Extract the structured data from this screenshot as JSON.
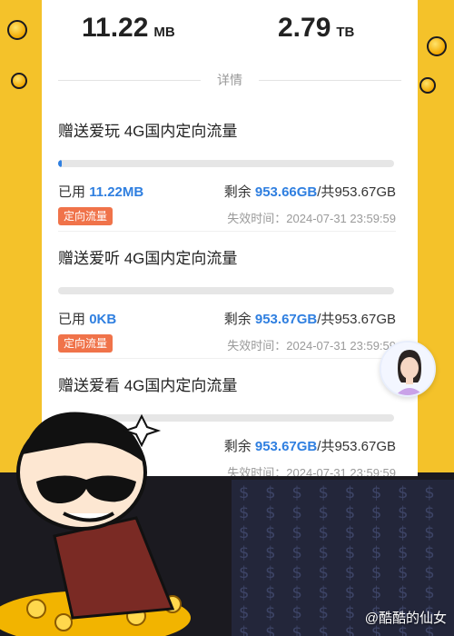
{
  "totals": [
    {
      "value": "11.22",
      "unit": "MB"
    },
    {
      "value": "2.79",
      "unit": "TB"
    }
  ],
  "section_label": "详情",
  "packages": [
    {
      "name": "赠送爱玩 4G国内定向流量",
      "used_label": "已用",
      "used_value": "11.22MB",
      "remain_label": "剩余",
      "remain_value": "953.66GB",
      "total_prefix": "/共",
      "total_value": "953.67GB",
      "usage_fraction": 0.012,
      "tag": "定向流量",
      "expire": "失效时间：2024-07-31 23:59:59"
    },
    {
      "name": "赠送爱听 4G国内定向流量",
      "used_label": "已用",
      "used_value": "0KB",
      "remain_label": "剩余",
      "remain_value": "953.67GB",
      "total_prefix": "/共",
      "total_value": "953.67GB",
      "usage_fraction": 0.0,
      "tag": "定向流量",
      "expire": "失效时间：2024-07-31 23:59:59"
    },
    {
      "name": "赠送爱看 4G国内定向流量",
      "remain_label": "剩余",
      "remain_value": "953.67GB",
      "total_prefix": "/共",
      "total_value": "953.67GB",
      "usage_fraction": 0.0,
      "expire": "失效时间：2024-07-31 23:59:59"
    }
  ],
  "watermark": "@酷酷的仙女",
  "colors": {
    "accent": "#2f7fe0",
    "tag": "#f0734a",
    "background": "#f4c22a"
  },
  "icons": [
    "assistant-avatar-icon",
    "coin-icon",
    "mascot-sunglasses-icon"
  ]
}
